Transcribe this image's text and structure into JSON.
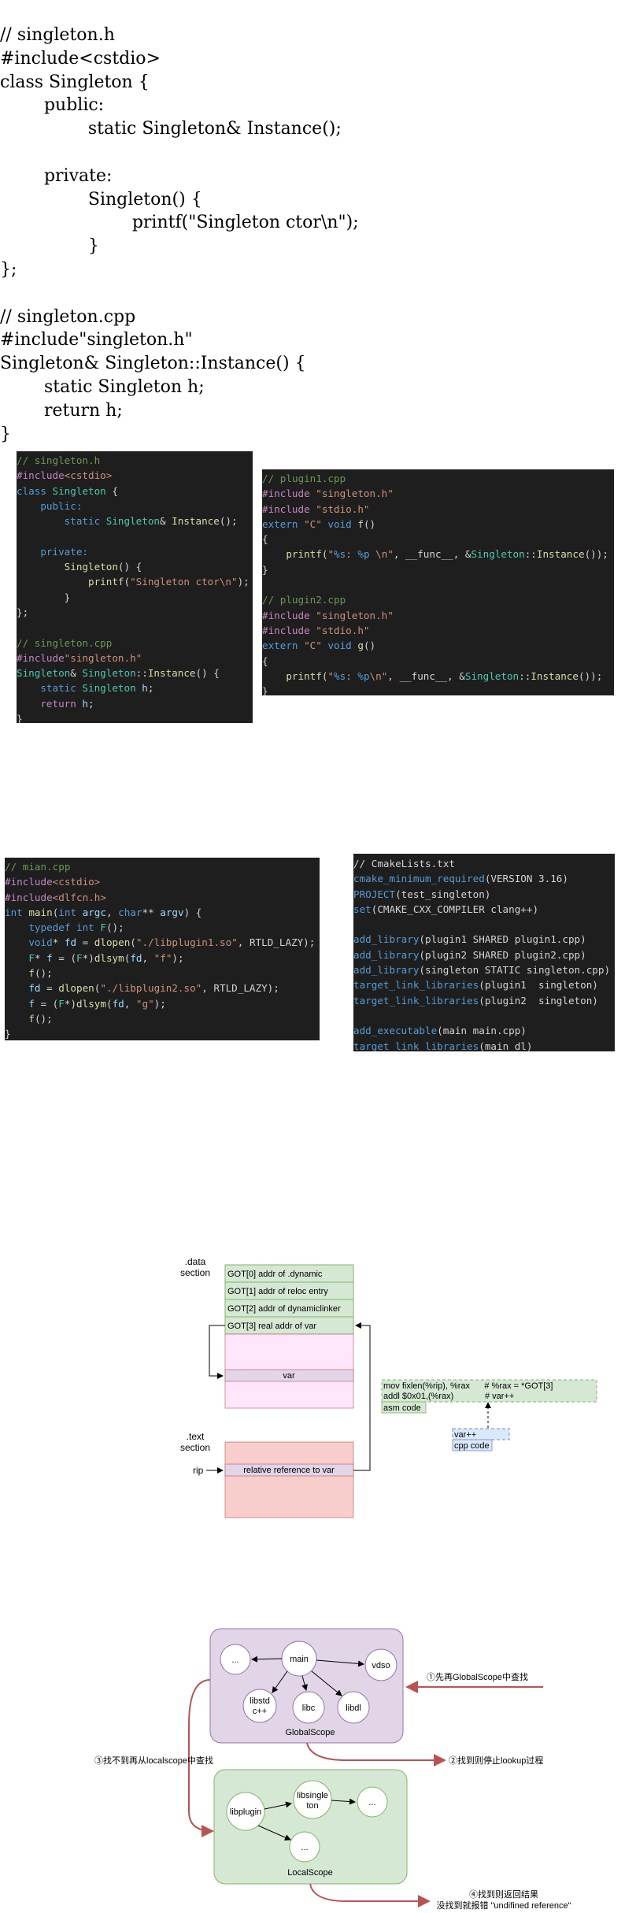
{
  "plain_code": {
    "lines": [
      "// singleton.h",
      "#include<cstdio>",
      "class Singleton {",
      "        public:",
      "                static Singleton& Instance();",
      "",
      "        private:",
      "                Singleton() {",
      "                        printf(\"Singleton ctor\\n\");",
      "                }",
      "};",
      "",
      "// singleton.cpp",
      "#include\"singleton.h\"",
      "Singleton& Singleton::Instance() {",
      "        static Singleton h;",
      "        return h;",
      "}"
    ]
  },
  "code_singleton": [
    [
      [
        "c-com",
        "// singleton.h"
      ]
    ],
    [
      [
        "c-pp",
        "#include"
      ],
      [
        "c-str",
        "<cstdio>"
      ]
    ],
    [
      [
        "c-kw",
        "class "
      ],
      [
        "c-type",
        "Singleton"
      ],
      [
        "c-plain",
        " {"
      ]
    ],
    [
      [
        "c-plain",
        "    "
      ],
      [
        "c-kw",
        "public:"
      ]
    ],
    [
      [
        "c-plain",
        "        "
      ],
      [
        "c-kw",
        "static "
      ],
      [
        "c-type",
        "Singleton"
      ],
      [
        "c-plain",
        "& "
      ],
      [
        "c-fn",
        "Instance"
      ],
      [
        "c-plain",
        "();"
      ]
    ],
    [
      [
        "c-plain",
        ""
      ]
    ],
    [
      [
        "c-plain",
        "    "
      ],
      [
        "c-kw",
        "private:"
      ]
    ],
    [
      [
        "c-plain",
        "        "
      ],
      [
        "c-fn",
        "Singleton"
      ],
      [
        "c-plain",
        "() {"
      ]
    ],
    [
      [
        "c-plain",
        "            "
      ],
      [
        "c-fn",
        "printf"
      ],
      [
        "c-plain",
        "("
      ],
      [
        "c-str",
        "\"Singleton ctor\\n\""
      ],
      [
        "c-plain",
        ");"
      ]
    ],
    [
      [
        "c-plain",
        "        }"
      ]
    ],
    [
      [
        "c-plain",
        "};"
      ]
    ],
    [
      [
        "c-plain",
        ""
      ]
    ],
    [
      [
        "c-com",
        "// singleton.cpp"
      ]
    ],
    [
      [
        "c-pp",
        "#include"
      ],
      [
        "c-str",
        "\"singleton.h\""
      ]
    ],
    [
      [
        "c-type",
        "Singleton"
      ],
      [
        "c-plain",
        "& "
      ],
      [
        "c-type",
        "Singleton"
      ],
      [
        "c-plain",
        "::"
      ],
      [
        "c-fn",
        "Instance"
      ],
      [
        "c-plain",
        "() {"
      ]
    ],
    [
      [
        "c-plain",
        "    "
      ],
      [
        "c-kw",
        "static "
      ],
      [
        "c-type",
        "Singleton "
      ],
      [
        "c-var",
        "h"
      ],
      [
        "c-plain",
        ";"
      ]
    ],
    [
      [
        "c-plain",
        "    "
      ],
      [
        "c-kw2",
        "return "
      ],
      [
        "c-var",
        "h"
      ],
      [
        "c-plain",
        ";"
      ]
    ],
    [
      [
        "c-plain",
        "}"
      ]
    ]
  ],
  "code_plugin": [
    [
      [
        "c-com",
        "// plugin1.cpp"
      ]
    ],
    [
      [
        "c-pp",
        "#include "
      ],
      [
        "c-str",
        "\"singleton.h\""
      ]
    ],
    [
      [
        "c-pp",
        "#include "
      ],
      [
        "c-str",
        "\"stdio.h\""
      ]
    ],
    [
      [
        "c-kw",
        "extern "
      ],
      [
        "c-str",
        "\"C\" "
      ],
      [
        "c-kw",
        "void "
      ],
      [
        "c-fn",
        "f"
      ],
      [
        "c-plain",
        "()"
      ]
    ],
    [
      [
        "c-plain",
        "{"
      ]
    ],
    [
      [
        "c-plain",
        "    "
      ],
      [
        "c-fn",
        "printf"
      ],
      [
        "c-plain",
        "("
      ],
      [
        "c-str",
        "\""
      ],
      [
        "c-fmt",
        "%s"
      ],
      [
        "c-str",
        ": "
      ],
      [
        "c-fmt",
        "%p"
      ],
      [
        "c-str",
        " \\n\""
      ],
      [
        "c-plain",
        ", __func__, &"
      ],
      [
        "c-type",
        "Singleton"
      ],
      [
        "c-plain",
        "::"
      ],
      [
        "c-fn",
        "Instance"
      ],
      [
        "c-plain",
        "());"
      ]
    ],
    [
      [
        "c-plain",
        "}"
      ]
    ],
    [
      [
        "c-plain",
        ""
      ]
    ],
    [
      [
        "c-com",
        "// plugin2.cpp"
      ]
    ],
    [
      [
        "c-pp",
        "#include "
      ],
      [
        "c-str",
        "\"singleton.h\""
      ]
    ],
    [
      [
        "c-pp",
        "#include "
      ],
      [
        "c-str",
        "\"stdio.h\""
      ]
    ],
    [
      [
        "c-kw",
        "extern "
      ],
      [
        "c-str",
        "\"C\" "
      ],
      [
        "c-kw",
        "void "
      ],
      [
        "c-fn",
        "g"
      ],
      [
        "c-plain",
        "()"
      ]
    ],
    [
      [
        "c-plain",
        "{"
      ]
    ],
    [
      [
        "c-plain",
        "    "
      ],
      [
        "c-fn",
        "printf"
      ],
      [
        "c-plain",
        "("
      ],
      [
        "c-str",
        "\""
      ],
      [
        "c-fmt",
        "%s"
      ],
      [
        "c-str",
        ": "
      ],
      [
        "c-fmt",
        "%p"
      ],
      [
        "c-str",
        "\\n\""
      ],
      [
        "c-plain",
        ", __func__, &"
      ],
      [
        "c-type",
        "Singleton"
      ],
      [
        "c-plain",
        "::"
      ],
      [
        "c-fn",
        "Instance"
      ],
      [
        "c-plain",
        "());"
      ]
    ],
    [
      [
        "c-plain",
        "}"
      ]
    ]
  ],
  "code_main": [
    [
      [
        "c-com",
        "// mian.cpp"
      ]
    ],
    [
      [
        "c-pp",
        "#include"
      ],
      [
        "c-str",
        "<cstdio>"
      ]
    ],
    [
      [
        "c-pp",
        "#include"
      ],
      [
        "c-str",
        "<dlfcn.h>"
      ]
    ],
    [
      [
        "c-kw",
        "int "
      ],
      [
        "c-fn",
        "main"
      ],
      [
        "c-plain",
        "("
      ],
      [
        "c-kw",
        "int "
      ],
      [
        "c-var",
        "argc"
      ],
      [
        "c-plain",
        ", "
      ],
      [
        "c-kw",
        "char"
      ],
      [
        "c-plain",
        "** "
      ],
      [
        "c-var",
        "argv"
      ],
      [
        "c-plain",
        ") {"
      ]
    ],
    [
      [
        "c-plain",
        "    "
      ],
      [
        "c-kw",
        "typedef int "
      ],
      [
        "c-type",
        "F"
      ],
      [
        "c-plain",
        "();"
      ]
    ],
    [
      [
        "c-plain",
        "    "
      ],
      [
        "c-kw",
        "void"
      ],
      [
        "c-plain",
        "* "
      ],
      [
        "c-var",
        "fd"
      ],
      [
        "c-plain",
        " = "
      ],
      [
        "c-fn",
        "dlopen"
      ],
      [
        "c-plain",
        "("
      ],
      [
        "c-str",
        "\"./libplugin1.so\""
      ],
      [
        "c-plain",
        ", RTLD_LAZY);"
      ]
    ],
    [
      [
        "c-plain",
        "    "
      ],
      [
        "c-type",
        "F"
      ],
      [
        "c-plain",
        "* "
      ],
      [
        "c-var",
        "f"
      ],
      [
        "c-plain",
        " = ("
      ],
      [
        "c-type",
        "F"
      ],
      [
        "c-plain",
        "*)"
      ],
      [
        "c-fn",
        "dlsym"
      ],
      [
        "c-plain",
        "("
      ],
      [
        "c-var",
        "fd"
      ],
      [
        "c-plain",
        ", "
      ],
      [
        "c-str",
        "\"f\""
      ],
      [
        "c-plain",
        ");"
      ]
    ],
    [
      [
        "c-plain",
        "    "
      ],
      [
        "c-fn",
        "f"
      ],
      [
        "c-plain",
        "();"
      ]
    ],
    [
      [
        "c-plain",
        "    "
      ],
      [
        "c-var",
        "fd"
      ],
      [
        "c-plain",
        " = "
      ],
      [
        "c-fn",
        "dlopen"
      ],
      [
        "c-plain",
        "("
      ],
      [
        "c-str",
        "\"./libplugin2.so\""
      ],
      [
        "c-plain",
        ", RTLD_LAZY);"
      ]
    ],
    [
      [
        "c-plain",
        "    "
      ],
      [
        "c-var",
        "f"
      ],
      [
        "c-plain",
        " = ("
      ],
      [
        "c-type",
        "F"
      ],
      [
        "c-plain",
        "*)"
      ],
      [
        "c-fn",
        "dlsym"
      ],
      [
        "c-plain",
        "("
      ],
      [
        "c-var",
        "fd"
      ],
      [
        "c-plain",
        ", "
      ],
      [
        "c-str",
        "\"g\""
      ],
      [
        "c-plain",
        ");"
      ]
    ],
    [
      [
        "c-plain",
        "    "
      ],
      [
        "c-fn",
        "f"
      ],
      [
        "c-plain",
        "();"
      ]
    ],
    [
      [
        "c-plain",
        "}"
      ]
    ]
  ],
  "code_cmake": [
    [
      [
        "c-plain",
        "// CmakeLists.txt"
      ]
    ],
    [
      [
        "c-cmake",
        "cmake_minimum_required"
      ],
      [
        "c-plain",
        "(VERSION 3.16)"
      ]
    ],
    [
      [
        "c-cmake",
        "PROJECT"
      ],
      [
        "c-plain",
        "(test_singleton)"
      ]
    ],
    [
      [
        "c-cmake",
        "set"
      ],
      [
        "c-plain",
        "(CMAKE_CXX_COMPILER clang++)"
      ]
    ],
    [
      [
        "c-plain",
        ""
      ]
    ],
    [
      [
        "c-cmake",
        "add_library"
      ],
      [
        "c-plain",
        "(plugin1 SHARED plugin1.cpp)"
      ]
    ],
    [
      [
        "c-cmake",
        "add_library"
      ],
      [
        "c-plain",
        "(plugin2 SHARED plugin2.cpp)"
      ]
    ],
    [
      [
        "c-cmake",
        "add_library"
      ],
      [
        "c-plain",
        "(singleton STATIC singleton.cpp)"
      ]
    ],
    [
      [
        "c-cmake",
        "target_link_libraries"
      ],
      [
        "c-plain",
        "(plugin1  singleton)"
      ]
    ],
    [
      [
        "c-cmake",
        "target_link_libraries"
      ],
      [
        "c-plain",
        "(plugin2  singleton)"
      ]
    ],
    [
      [
        "c-plain",
        ""
      ]
    ],
    [
      [
        "c-cmake",
        "add_executable"
      ],
      [
        "c-plain",
        "(main main.cpp)"
      ]
    ],
    [
      [
        "c-cmake",
        "target_link_libraries"
      ],
      [
        "c-plain",
        "(main dl)"
      ]
    ]
  ],
  "got_diagram": {
    "data_section_label": [
      ".data",
      "section"
    ],
    "text_section_label": [
      ".text",
      "section"
    ],
    "rip_label": "rip",
    "got_entries": [
      "GOT[0] addr of .dynamic",
      "GOT[1] addr of reloc entry",
      "GOT[2] addr of dynamiclinker",
      "GOT[3] real addr of var"
    ],
    "var_label": "var",
    "relative_ref_label": "relative reference to var",
    "asm_lines": [
      "mov fixlen(%rip), %rax      # %rax = *GOT[3]",
      "addl $0x01,(%rax)             # var++"
    ],
    "asm_tag": "asm code",
    "cpp_line": "var++",
    "cpp_tag": "cpp code",
    "colors": {
      "green_fill": "#d5e8d4",
      "green_stroke": "#82b366",
      "pink_fill": "#ffe6fa",
      "pink_stroke": "#b85450",
      "red_fill": "#f8cecc",
      "band_fill": "#e1d5e7",
      "blue_fill": "#dae8fc",
      "blue_stroke": "#6c8ebf"
    }
  },
  "scope_diagram": {
    "global_label": "GlobalScope",
    "local_label": "LocalScope",
    "nodes": {
      "dots1": "...",
      "main": "main",
      "vdso": "vdso",
      "libstd": [
        "libstd",
        "c++"
      ],
      "libc": "libc",
      "libdl": "libdl",
      "libplugin": "libplugin",
      "libsingleton": [
        "libsingle",
        "ton"
      ],
      "dots2": "...",
      "dots3": "..."
    },
    "step1": "①先再GlobalScope中查找",
    "step2": "②找到则停止lookup过程",
    "step3": "③找不到再从localscope中查找",
    "step4": [
      "④找到则返回结果",
      "没找到就报错 \"undifined reference\""
    ],
    "colors": {
      "global_fill": "#e1d5e7",
      "global_stroke": "#9673a6",
      "local_fill": "#d5e8d4",
      "local_stroke": "#82b366",
      "arrow_red": "#b85450"
    }
  }
}
